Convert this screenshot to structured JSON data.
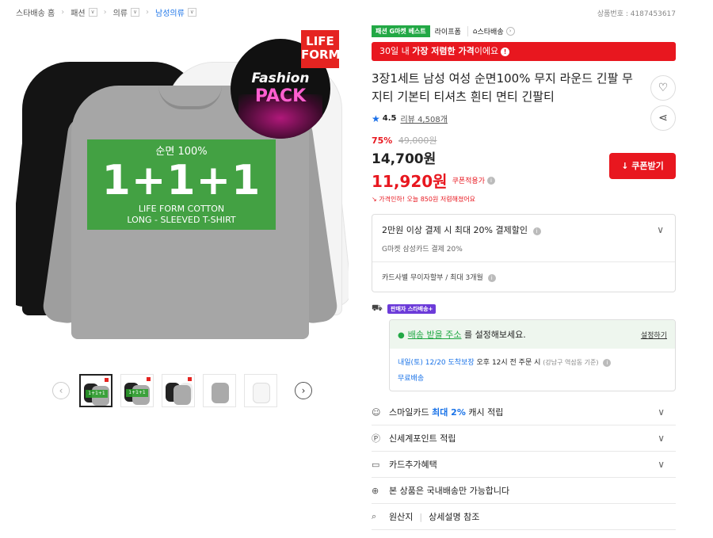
{
  "breadcrumb": {
    "items": [
      {
        "label": "스타배송 홈",
        "dropdown": false
      },
      {
        "label": "패션",
        "dropdown": true
      },
      {
        "label": "의류",
        "dropdown": true
      },
      {
        "label": "남성의류",
        "dropdown": true
      }
    ],
    "dropdown_glyph": "∨",
    "separator": "›"
  },
  "product_number": "상품번호 : 4187453617",
  "hero": {
    "life_badge": "LIFE FORM",
    "fashion_pack_line1": "Fashion",
    "fashion_pack_line2": "PACK",
    "cotton_label": "순면 100%",
    "bundle": "1+1+1",
    "line1": "LIFE FORM COTTON",
    "line2": "LONG - SLEEVED T-SHIRT"
  },
  "thumbnails": {
    "prev": "‹",
    "next": "›",
    "bundle_label": "1+1+1",
    "count": 5
  },
  "tags": {
    "best": "패션 G마켓 베스트",
    "brand": "라이프폼",
    "store": "스타배송",
    "arrow": "›"
  },
  "banner": {
    "prefix": "30일 내 ",
    "bold": "가장 저렴한 가격",
    "suffix": "이에요",
    "info": "!"
  },
  "product": {
    "title": "3장1세트 남성 여성 순면100% 무지 라운드 긴팔 무지티 기본티 티셔츠 흰티 면티 긴팔티",
    "rating": "4.5",
    "reviews": "리뷰 4,508개"
  },
  "price": {
    "discount": "75%",
    "original": "49,000원",
    "sale": "14,700원",
    "coupon_price": "11,920원",
    "coupon_label": "쿠폰적용가",
    "price_drop": "가격인하! 오늘 850원 저렴해졌어요",
    "coupon_button": "↓ 쿠폰받기"
  },
  "card_offer": {
    "title": "2만원 이상 결제 시 최대 20% 결제할인",
    "subtitle": "G마켓 삼성카드 결제 20%",
    "installment": "카드사별 무이자할부 / 최대 3개월"
  },
  "shipping": {
    "badge": "판매자 스타배송+",
    "address_link": "배송 받을 주소",
    "address_suffix": " 를 설정해보세요.",
    "set_button": "설정하기",
    "arrival_date": "내일(토) 12/20 도착보장",
    "arrival_cond": " 오후 12시 전 주문 시",
    "arrival_loc": "(강남구 역삼동 기준)",
    "free": "무료배송"
  },
  "benefits": [
    {
      "prefix": "스마일카드 ",
      "highlight": "최대 2%",
      "suffix": " 캐시 적립",
      "icon": "smile-icon",
      "glyph": "☺",
      "chevron": true
    },
    {
      "prefix": "신세계포인트 적립",
      "highlight": "",
      "suffix": "",
      "icon": "point-icon",
      "glyph": "Ⓟ",
      "chevron": true
    },
    {
      "prefix": "카드추가혜택",
      "highlight": "",
      "suffix": "",
      "icon": "card-icon",
      "glyph": "▭",
      "chevron": true
    },
    {
      "prefix": "본 상품은 국내배송만 가능합니다",
      "highlight": "",
      "suffix": "",
      "icon": "globe-icon",
      "glyph": "⊕",
      "chevron": false
    }
  ],
  "origin": {
    "label": "원산지",
    "value": "상세설명 참조"
  },
  "colors": {
    "accent_red": "#e8171f",
    "brand_green": "#22a845",
    "link_blue": "#1a73e8"
  }
}
